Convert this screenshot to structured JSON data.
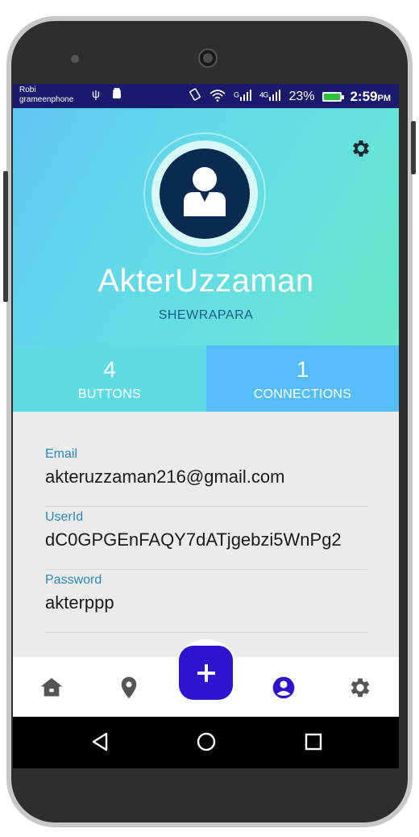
{
  "status_bar": {
    "carrier_line1": "Robi",
    "carrier_line2": "grameenphone",
    "signal1": "G",
    "signal2": "4G",
    "battery_percent": "23%",
    "time": "2:59",
    "time_suffix": "PM"
  },
  "profile": {
    "name": "AkterUzzaman",
    "location": "SHEWRAPARA"
  },
  "stats": {
    "buttons_count": "4",
    "buttons_label": "BUTTONS",
    "connections_count": "1",
    "connections_label": "CONNECTIONS"
  },
  "info": [
    {
      "label": "Email",
      "value": "akteruzzaman216@gmail.com"
    },
    {
      "label": "UserId",
      "value": "dC0GPGEnFAQY7dATjgebzi5WnPg2"
    },
    {
      "label": "Password",
      "value": "akterppp"
    }
  ],
  "bottom_nav": {
    "items": [
      {
        "name": "home-icon",
        "active": false
      },
      {
        "name": "location-pin-icon",
        "active": false
      },
      {
        "name": "add-button",
        "active": false
      },
      {
        "name": "account-circle-icon",
        "active": true
      },
      {
        "name": "settings-gear-icon",
        "active": false
      }
    ],
    "fab_symbol": "+"
  },
  "colors": {
    "status_bar": "#1c1a6e",
    "header_gradient_start": "#5ec8f2",
    "header_gradient_end": "#69e7c8",
    "fab": "#2d14d0",
    "active_nav": "#2d14d0",
    "inactive_nav": "#555555",
    "label": "#2c87c4"
  }
}
